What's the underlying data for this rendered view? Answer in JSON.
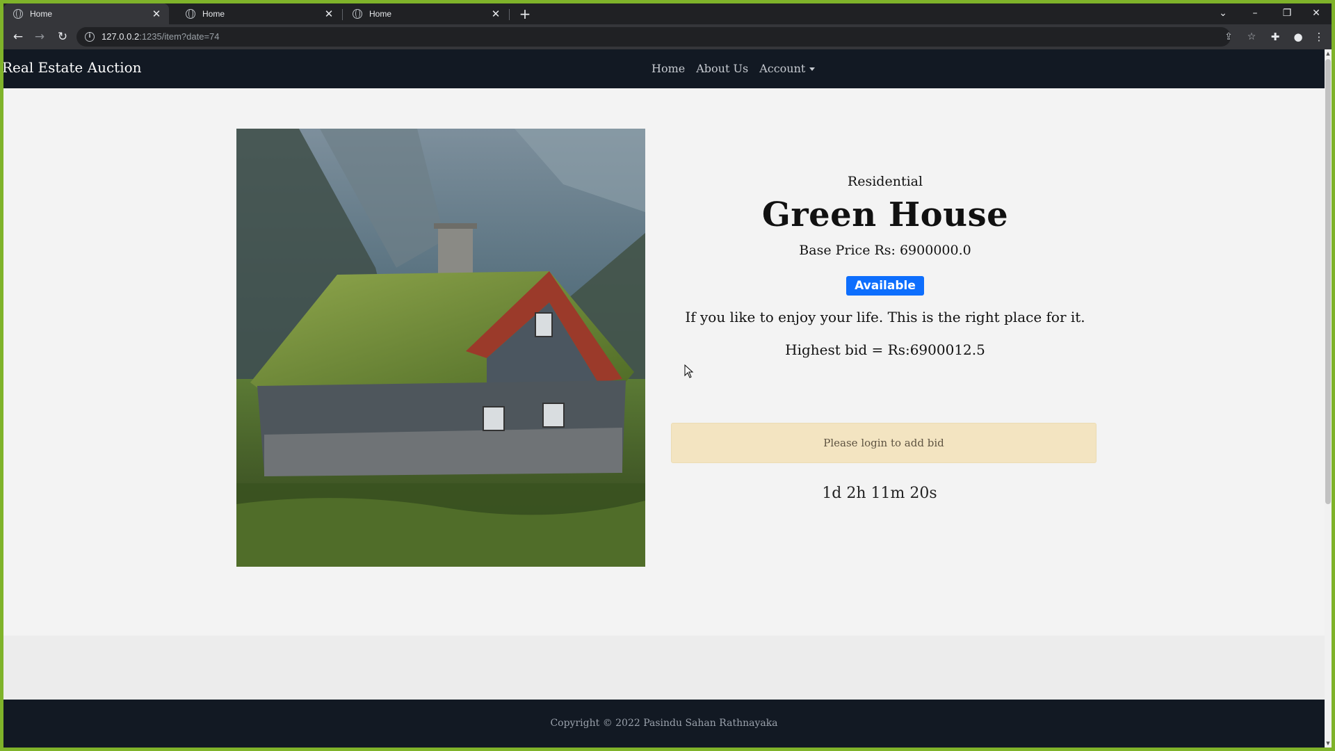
{
  "browser": {
    "tabs": [
      {
        "title": "Home",
        "close": "✕"
      },
      {
        "title": "Home",
        "close": "✕"
      },
      {
        "title": "Home",
        "close": "✕"
      }
    ],
    "new_tab": "+",
    "url_host": "127.0.0.2",
    "url_rest": ":1235/item?date=74",
    "window_controls": {
      "dropdown": "⌄",
      "minimize": "–",
      "restore": "❐",
      "close": "✕"
    },
    "nav_icons": {
      "back": "←",
      "forward": "→",
      "reload": "↻"
    },
    "toolbar_icons": {
      "share": "⇪",
      "bookmark": "☆",
      "extensions": "✚",
      "profile": "●",
      "menu": "⋮"
    }
  },
  "site": {
    "brand": "Real Estate Auction",
    "nav": {
      "home": "Home",
      "about": "About Us",
      "account": "Account"
    }
  },
  "item": {
    "image_alt": "house-photo",
    "category": "Residential",
    "name": "Green House",
    "base_price": "Base Price Rs: 6900000.0",
    "status": "Available",
    "description": "If you like to enjoy your life. This is the right place for it.",
    "highest_bid": "Highest bid = Rs:6900012.5",
    "login_notice": "Please login to add bid",
    "countdown": "1d 2h 11m 20s"
  },
  "footer": {
    "copyright": "Copyright © 2022 Pasindu Sahan Rathnayaka"
  },
  "colors": {
    "frame": "#7fb32a",
    "navbar": "#121923",
    "badge": "#0d6efd",
    "alert": "#f3e4c1"
  }
}
